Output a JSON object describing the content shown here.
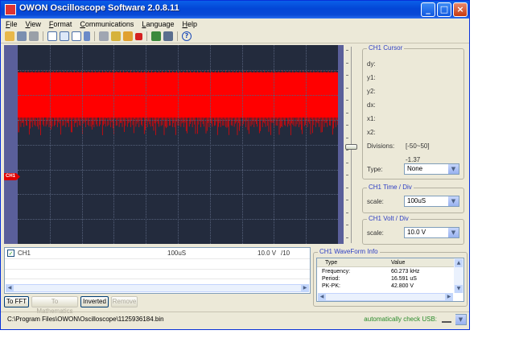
{
  "window": {
    "title": "OWON Oscilloscope Software 2.0.8.11"
  },
  "menu": [
    "File",
    "View",
    "Format",
    "Communications",
    "Language",
    "Help"
  ],
  "toolbar_icons": [
    "open-icon",
    "save-icon",
    "print-icon",
    "list-view-icon",
    "grid-view-icon",
    "dots-view-icon",
    "points-view-icon",
    "connect-icon",
    "get-data-icon",
    "auto-icon",
    "stop-icon",
    "export-icon",
    "device-icon",
    "help-icon"
  ],
  "help_glyph": "?",
  "scope": {
    "channel_marker": "CH1",
    "trace_color": "#ff0000",
    "background": "#232b3d"
  },
  "cursor": {
    "group_title": "CH1 Cursor",
    "labels": {
      "dy": "dy:",
      "y1": "y1:",
      "y2": "y2:",
      "dx": "dx:",
      "x1": "x1:",
      "x2": "x2:",
      "divisions": "Divisions:",
      "type": "Type:"
    },
    "divisions_range": "[-50~50]",
    "divisions_value": "-1.37",
    "type_value": "None"
  },
  "time_div": {
    "group_title": "CH1 Time / Div",
    "scale_label": "scale:",
    "scale_value": "100uS"
  },
  "volt_div": {
    "group_title": "CH1 Volt / Div",
    "scale_label": "scale:",
    "scale_value": "10.0 V"
  },
  "channel_panel": {
    "checked": "✓",
    "channel": "CH1",
    "timebase": "100uS",
    "volts": "10.0 V",
    "probe": "/10"
  },
  "buttons": {
    "to_fft": "To FFT",
    "to_math": "To Mathematics",
    "inverted": "Inverted",
    "remove": "Remove"
  },
  "waveform_info": {
    "group_title": "CH1 WaveForm Info",
    "headers": [
      "Type",
      "Value"
    ],
    "rows": [
      {
        "type": "Frequency:",
        "value": "60.273 kHz"
      },
      {
        "type": "Period:",
        "value": "16.591 uS"
      },
      {
        "type": "PK-PK:",
        "value": "42.800 V"
      }
    ]
  },
  "status": {
    "path": "C:\\Program Files\\OWON\\Oscilloscope\\1125936184.bin",
    "usb": "automatically check USB:"
  }
}
